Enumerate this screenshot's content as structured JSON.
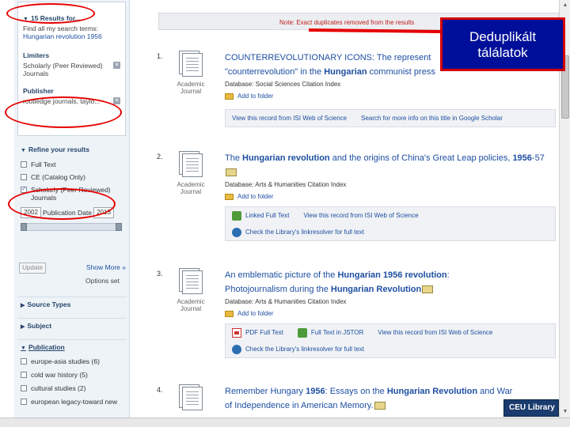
{
  "sidebar": {
    "results_header": "15 Results for...",
    "find_all_text": "Find all my search terms:",
    "search_query": "Hungarian revolution 1956",
    "limiters_title": "Limiters",
    "limiter_value_1": "Scholarly (Peer Reviewed)",
    "limiter_value_2": "Journals",
    "publisher_title": "Publisher",
    "publisher_value": "routledge journals, taylo...",
    "refine_title": "Refine your results",
    "checkboxes": [
      {
        "label": "Full Text",
        "checked": false
      },
      {
        "label": "CE (Catalog Only)",
        "checked": false
      },
      {
        "label": "Scholarly (Peer Reviewed) Journals",
        "checked": true
      }
    ],
    "date_from": "2002",
    "date_label": "Publication Date",
    "date_to": "2013",
    "update_label": "Update",
    "show_more": "Show More »",
    "options_set": "Options set",
    "facets": [
      "Source Types",
      "Subject",
      "Publication"
    ],
    "publications": [
      "europe-asia studies (6)",
      "cold war history (5)",
      "cultural studies (2)",
      "european legacy-toward new"
    ]
  },
  "main": {
    "note": "Note: Exact duplicates removed from the results",
    "results": [
      {
        "num": "1.",
        "type": "Academic Journal",
        "title_parts": [
          "COUNTERREVOLUTIONARY ICONS: The represent",
          "\"counterrevolution\" in the ",
          "Hungarian",
          " communist press"
        ],
        "database": "Database: Social Sciences Citation Index",
        "folder": "Add to folder",
        "links": [
          "View this record from ISI Web of Science",
          "Search for more info on this title in Google Scholar"
        ]
      },
      {
        "num": "2.",
        "type": "Academic Journal",
        "title_parts": [
          "The ",
          "Hungarian revolution",
          " and the origins of China's Great Leap policies, ",
          "1956",
          "-57"
        ],
        "database": "Database: Arts & Humanities Citation Index",
        "folder": "Add to folder",
        "links": [
          "Linked Full Text",
          "View this record from ISI Web of Science",
          "Check the Library's linkresolver for full text"
        ]
      },
      {
        "num": "3.",
        "type": "Academic Journal",
        "title_parts": [
          "An emblematic picture of the ",
          "Hungarian 1956 revolution",
          ":",
          "Photojournalism during the ",
          "Hungarian Revolution"
        ],
        "database": "Database: Arts & Humanities Citation Index",
        "folder": "Add to folder",
        "links": [
          "PDF Full Text",
          "Full Text in JSTOR",
          "View this record from ISI Web of Science",
          "Check the Library's linkresolver for full text"
        ]
      },
      {
        "num": "4.",
        "type": "",
        "title_parts": [
          "Remember Hungary ",
          "1956",
          ": Essays on the ",
          "Hungarian Revolution",
          " and War",
          "of Independence in American Memory."
        ]
      }
    ]
  },
  "callout": {
    "line1": "Deduplikált",
    "line2": "tálálatok"
  },
  "logo": "CEU Library",
  "colors": {
    "callout_bg": "#000f99",
    "callout_border": "#d40000",
    "annotation_red": "#e60000",
    "link_blue": "#1e4fa1"
  }
}
